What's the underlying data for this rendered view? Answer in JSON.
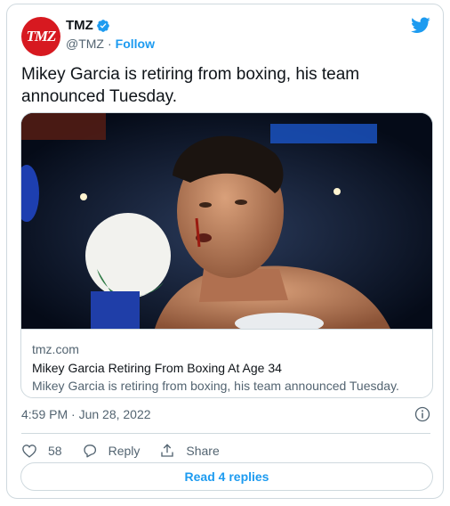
{
  "author": {
    "display_name": "TMZ",
    "handle": "@TMZ",
    "separator": "·",
    "follow_label": "Follow",
    "avatar_text": "TMZ",
    "avatar_color": "#d71920"
  },
  "tweet": {
    "text": "Mikey Garcia is retiring from boxing, his team announced Tuesday."
  },
  "link_card": {
    "domain": "tmz.com",
    "title": "Mikey Garcia Retiring From Boxing At Age 34",
    "description": "Mikey Garcia is retiring from boxing, his team announced Tuesday."
  },
  "meta": {
    "timestamp": "4:59 PM · Jun 28, 2022"
  },
  "actions": {
    "likes_count": "58",
    "reply_label": "Reply",
    "share_label": "Share"
  },
  "read_replies_label": "Read 4 replies",
  "colors": {
    "accent": "#1d9bf0",
    "muted": "#536471",
    "border": "#cfd9de",
    "text": "#0f1419"
  },
  "icons": [
    "verified-badge-icon",
    "twitter-bird-icon",
    "info-icon",
    "heart-icon",
    "reply-icon",
    "share-icon"
  ]
}
